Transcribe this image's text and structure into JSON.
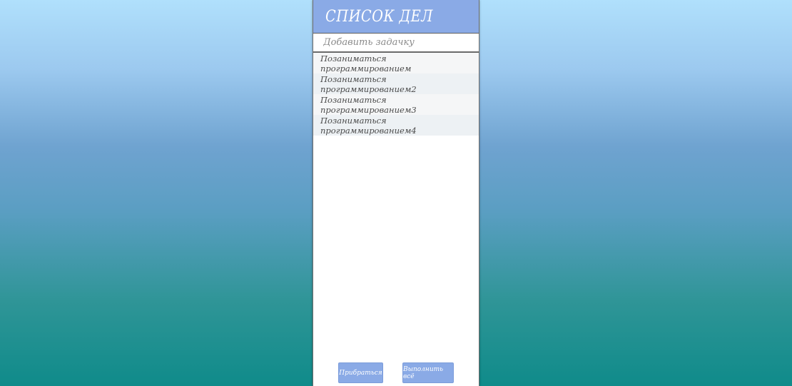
{
  "header": {
    "title": "СПИСОК ДЕЛ"
  },
  "new_task": {
    "placeholder": "Добавить задачку",
    "value": ""
  },
  "tasks": [
    {
      "label": "Позаниматься программированием"
    },
    {
      "label": "Позаниматься программированием2"
    },
    {
      "label": "Позаниматься программированием3"
    },
    {
      "label": "Позаниматься программированием4"
    }
  ],
  "footer": {
    "clean_label": "Прибраться",
    "complete_all_label": "Выполнить всё"
  },
  "colors": {
    "accent": "#8aaae6",
    "background_top": "#b0e0fc",
    "background_bottom": "#0f8b8a"
  }
}
